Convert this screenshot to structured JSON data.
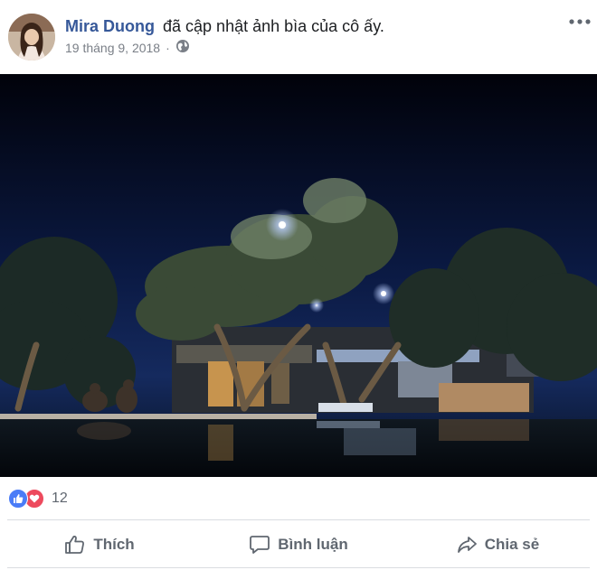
{
  "post": {
    "author_name": "Mira Duong",
    "action_text": "đã cập nhật ảnh bìa của cô ấy.",
    "timestamp": "19 tháng 9, 2018",
    "separator": "·",
    "privacy_icon": "globe-icon",
    "more_icon": "more-options-icon"
  },
  "photo": {
    "description_icon": "cover-photo"
  },
  "reactions": {
    "types": [
      "like",
      "love"
    ],
    "count": "12",
    "colors": {
      "like": "#4a7cf7",
      "love": "#ed4a5d"
    }
  },
  "actions": {
    "like_label": "Thích",
    "comment_label": "Bình luận",
    "share_label": "Chia sẻ"
  },
  "colors": {
    "author": "#365899",
    "meta": "#7a7f87",
    "action_text": "#606770"
  }
}
